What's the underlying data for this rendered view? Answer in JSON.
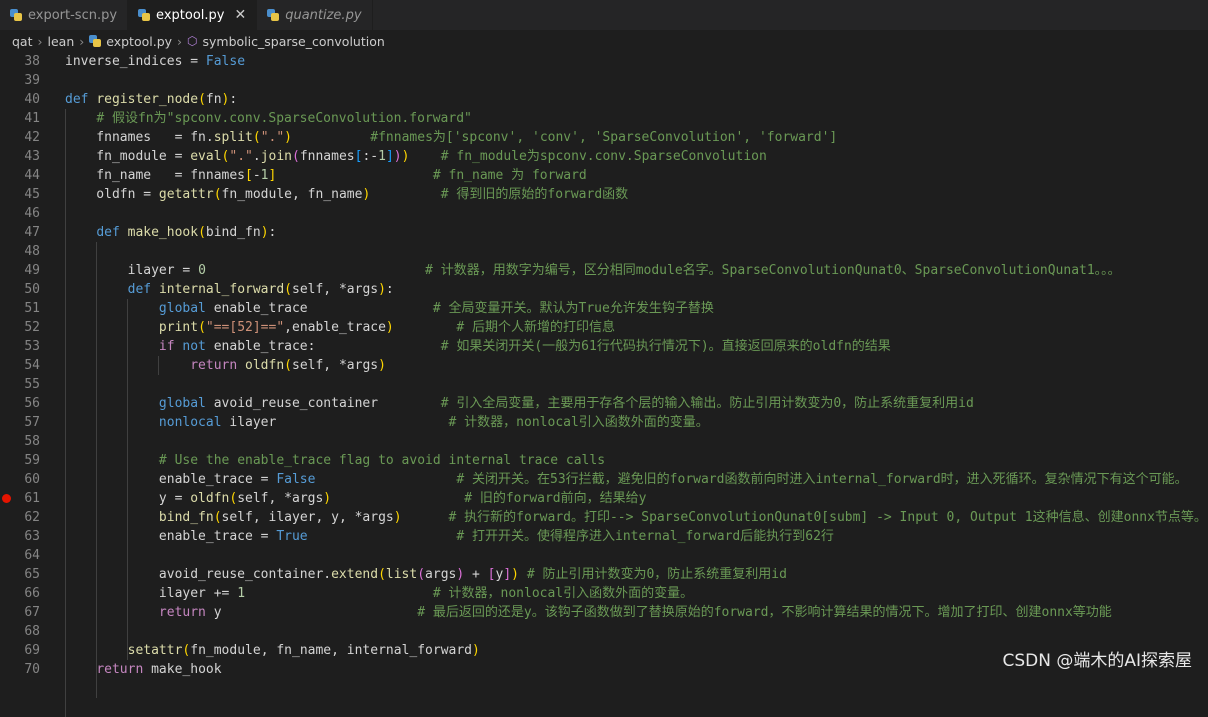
{
  "tabs": [
    {
      "label": "export-scn.py",
      "active": false,
      "italic": false
    },
    {
      "label": "exptool.py",
      "active": true,
      "italic": false
    },
    {
      "label": "quantize.py",
      "active": false,
      "italic": true
    }
  ],
  "breadcrumb": [
    "qat",
    "lean",
    "exptool.py",
    "symbolic_sparse_convolution"
  ],
  "breakpoint_line": "61",
  "lines": [
    {
      "n": "38",
      "tokens": [
        [
          "",
          "inverse_indices = "
        ],
        [
          "kw",
          "False"
        ]
      ]
    },
    {
      "n": "39",
      "tokens": []
    },
    {
      "n": "40",
      "tokens": [
        [
          "kw",
          "def "
        ],
        [
          "fn",
          "register_node"
        ],
        [
          "br1",
          "("
        ],
        [
          "",
          "fn"
        ],
        [
          "br1",
          ")"
        ],
        [
          "",
          ":"
        ]
      ]
    },
    {
      "n": "41",
      "tokens": [
        [
          "",
          "    "
        ],
        [
          "com",
          "# 假设fn为\"spconv.conv.SparseConvolution.forward\""
        ]
      ]
    },
    {
      "n": "42",
      "tokens": [
        [
          "",
          "    fnnames   = fn."
        ],
        [
          "fn",
          "split"
        ],
        [
          "br1",
          "("
        ],
        [
          "str",
          "\".\""
        ],
        [
          "br1",
          ")"
        ],
        [
          "",
          "          "
        ],
        [
          "com",
          "#fnnames为['spconv', 'conv', 'SparseConvolution', 'forward']"
        ]
      ]
    },
    {
      "n": "43",
      "tokens": [
        [
          "",
          "    fn_module = "
        ],
        [
          "fn",
          "eval"
        ],
        [
          "br1",
          "("
        ],
        [
          "str",
          "\".\""
        ],
        [
          "",
          "."
        ],
        [
          "fn",
          "join"
        ],
        [
          "br2",
          "("
        ],
        [
          "",
          "fnnames"
        ],
        [
          "br3",
          "["
        ],
        [
          "",
          ":-"
        ],
        [
          "num",
          "1"
        ],
        [
          "br3",
          "]"
        ],
        [
          "br2",
          ")"
        ],
        [
          "br1",
          ")"
        ],
        [
          "",
          "    "
        ],
        [
          "com",
          "# fn_module为spconv.conv.SparseConvolution"
        ]
      ]
    },
    {
      "n": "44",
      "tokens": [
        [
          "",
          "    fn_name   = fnnames"
        ],
        [
          "br1",
          "["
        ],
        [
          "",
          "-"
        ],
        [
          "num",
          "1"
        ],
        [
          "br1",
          "]"
        ],
        [
          "",
          "                    "
        ],
        [
          "com",
          "# fn_name 为 forward"
        ]
      ]
    },
    {
      "n": "45",
      "tokens": [
        [
          "",
          "    oldfn = "
        ],
        [
          "fn",
          "getattr"
        ],
        [
          "br1",
          "("
        ],
        [
          "",
          "fn_module, fn_name"
        ],
        [
          "br1",
          ")"
        ],
        [
          "",
          "         "
        ],
        [
          "com",
          "# 得到旧的原始的forward函数"
        ]
      ]
    },
    {
      "n": "46",
      "tokens": []
    },
    {
      "n": "47",
      "tokens": [
        [
          "",
          "    "
        ],
        [
          "kw",
          "def "
        ],
        [
          "fn",
          "make_hook"
        ],
        [
          "br1",
          "("
        ],
        [
          "",
          "bind_fn"
        ],
        [
          "br1",
          ")"
        ],
        [
          "",
          ":"
        ]
      ]
    },
    {
      "n": "48",
      "tokens": []
    },
    {
      "n": "49",
      "tokens": [
        [
          "",
          "        ilayer = "
        ],
        [
          "num",
          "0"
        ],
        [
          "",
          "                            "
        ],
        [
          "com",
          "# 计数器，用数字为编号，区分相同module名字。SparseConvolutionQunat0、SparseConvolutionQunat1。。。"
        ]
      ]
    },
    {
      "n": "50",
      "tokens": [
        [
          "",
          "        "
        ],
        [
          "kw",
          "def "
        ],
        [
          "fn",
          "internal_forward"
        ],
        [
          "br1",
          "("
        ],
        [
          "",
          "self, *args"
        ],
        [
          "br1",
          ")"
        ],
        [
          "",
          ":"
        ]
      ]
    },
    {
      "n": "51",
      "tokens": [
        [
          "",
          "            "
        ],
        [
          "kw",
          "global"
        ],
        [
          "",
          " enable_trace                "
        ],
        [
          "com",
          "# 全局变量开关。默认为True允许发生钩子替换"
        ]
      ]
    },
    {
      "n": "52",
      "tokens": [
        [
          "",
          "            "
        ],
        [
          "fn",
          "print"
        ],
        [
          "br1",
          "("
        ],
        [
          "str",
          "\"==[52]==\""
        ],
        [
          "",
          ",enable_trace"
        ],
        [
          "br1",
          ")"
        ],
        [
          "",
          "        "
        ],
        [
          "com",
          "# 后期个人新增的打印信息"
        ]
      ]
    },
    {
      "n": "53",
      "tokens": [
        [
          "",
          "            "
        ],
        [
          "kc",
          "if"
        ],
        [
          "",
          " "
        ],
        [
          "kw",
          "not"
        ],
        [
          "",
          " enable_trace:                "
        ],
        [
          "com",
          "# 如果关闭开关(一般为61行代码执行情况下)。直接返回原来的oldfn的结果"
        ]
      ]
    },
    {
      "n": "54",
      "tokens": [
        [
          "",
          "                "
        ],
        [
          "kc",
          "return"
        ],
        [
          "",
          " "
        ],
        [
          "fn",
          "oldfn"
        ],
        [
          "br1",
          "("
        ],
        [
          "",
          "self, *args"
        ],
        [
          "br1",
          ")"
        ]
      ]
    },
    {
      "n": "55",
      "tokens": []
    },
    {
      "n": "56",
      "tokens": [
        [
          "",
          "            "
        ],
        [
          "kw",
          "global"
        ],
        [
          "",
          " avoid_reuse_container        "
        ],
        [
          "com",
          "# 引入全局变量，主要用于存各个层的输入输出。防止引用计数变为0，防止系统重复利用id"
        ]
      ]
    },
    {
      "n": "57",
      "tokens": [
        [
          "",
          "            "
        ],
        [
          "kw",
          "nonlocal"
        ],
        [
          "",
          " ilayer                      "
        ],
        [
          "com",
          "# 计数器，nonlocal引入函数外面的变量。"
        ]
      ]
    },
    {
      "n": "58",
      "tokens": []
    },
    {
      "n": "59",
      "tokens": [
        [
          "",
          "            "
        ],
        [
          "com",
          "# Use the enable_trace flag to avoid internal trace calls"
        ]
      ]
    },
    {
      "n": "60",
      "tokens": [
        [
          "",
          "            enable_trace = "
        ],
        [
          "kw",
          "False"
        ],
        [
          "",
          "                  "
        ],
        [
          "com",
          "# 关闭开关。在53行拦截，避免旧的forward函数前向时进入internal_forward时，进入死循环。复杂情况下有这个可能。"
        ]
      ]
    },
    {
      "n": "61",
      "tokens": [
        [
          "",
          "            y = "
        ],
        [
          "fn",
          "oldfn"
        ],
        [
          "br1",
          "("
        ],
        [
          "",
          "self, *args"
        ],
        [
          "br1",
          ")"
        ],
        [
          "",
          "                 "
        ],
        [
          "com",
          "# 旧的forward前向，结果给y"
        ]
      ]
    },
    {
      "n": "62",
      "tokens": [
        [
          "",
          "            "
        ],
        [
          "fn",
          "bind_fn"
        ],
        [
          "br1",
          "("
        ],
        [
          "",
          "self, ilayer, y, *args"
        ],
        [
          "br1",
          ")"
        ],
        [
          "",
          "      "
        ],
        [
          "com",
          "# 执行新的forward。打印--> SparseConvolutionQunat0[subm] -> Input 0, Output 1这种信息、创建onnx节点等。"
        ]
      ]
    },
    {
      "n": "63",
      "tokens": [
        [
          "",
          "            enable_trace = "
        ],
        [
          "kw",
          "True"
        ],
        [
          "",
          "                   "
        ],
        [
          "com",
          "# 打开开关。使得程序进入internal_forward后能执行到62行"
        ]
      ]
    },
    {
      "n": "64",
      "tokens": []
    },
    {
      "n": "65",
      "tokens": [
        [
          "",
          "            avoid_reuse_container."
        ],
        [
          "fn",
          "extend"
        ],
        [
          "br1",
          "("
        ],
        [
          "fn",
          "list"
        ],
        [
          "br2",
          "("
        ],
        [
          "",
          "args"
        ],
        [
          "br2",
          ")"
        ],
        [
          "",
          " + "
        ],
        [
          "br2",
          "["
        ],
        [
          "",
          "y"
        ],
        [
          "br2",
          "]"
        ],
        [
          "br1",
          ")"
        ],
        [
          "",
          " "
        ],
        [
          "com",
          "# 防止引用计数变为0，防止系统重复利用id"
        ]
      ]
    },
    {
      "n": "66",
      "tokens": [
        [
          "",
          "            ilayer += "
        ],
        [
          "num",
          "1"
        ],
        [
          "",
          "                        "
        ],
        [
          "com",
          "# 计数器，nonlocal引入函数外面的变量。"
        ]
      ]
    },
    {
      "n": "67",
      "tokens": [
        [
          "",
          "            "
        ],
        [
          "kc",
          "return"
        ],
        [
          "",
          " y                         "
        ],
        [
          "com",
          "# 最后返回的还是y。该钩子函数做到了替换原始的forward，不影响计算结果的情况下。增加了打印、创建onnx等功能"
        ]
      ]
    },
    {
      "n": "68",
      "tokens": []
    },
    {
      "n": "69",
      "tokens": [
        [
          "",
          "        "
        ],
        [
          "fn",
          "setattr"
        ],
        [
          "br1",
          "("
        ],
        [
          "",
          "fn_module, fn_name, internal_forward"
        ],
        [
          "br1",
          ")"
        ]
      ]
    },
    {
      "n": "70",
      "tokens": [
        [
          "",
          "    "
        ],
        [
          "kc",
          "return"
        ],
        [
          "",
          " make_hook"
        ]
      ]
    }
  ],
  "watermark": "CSDN @端木的AI探索屋"
}
